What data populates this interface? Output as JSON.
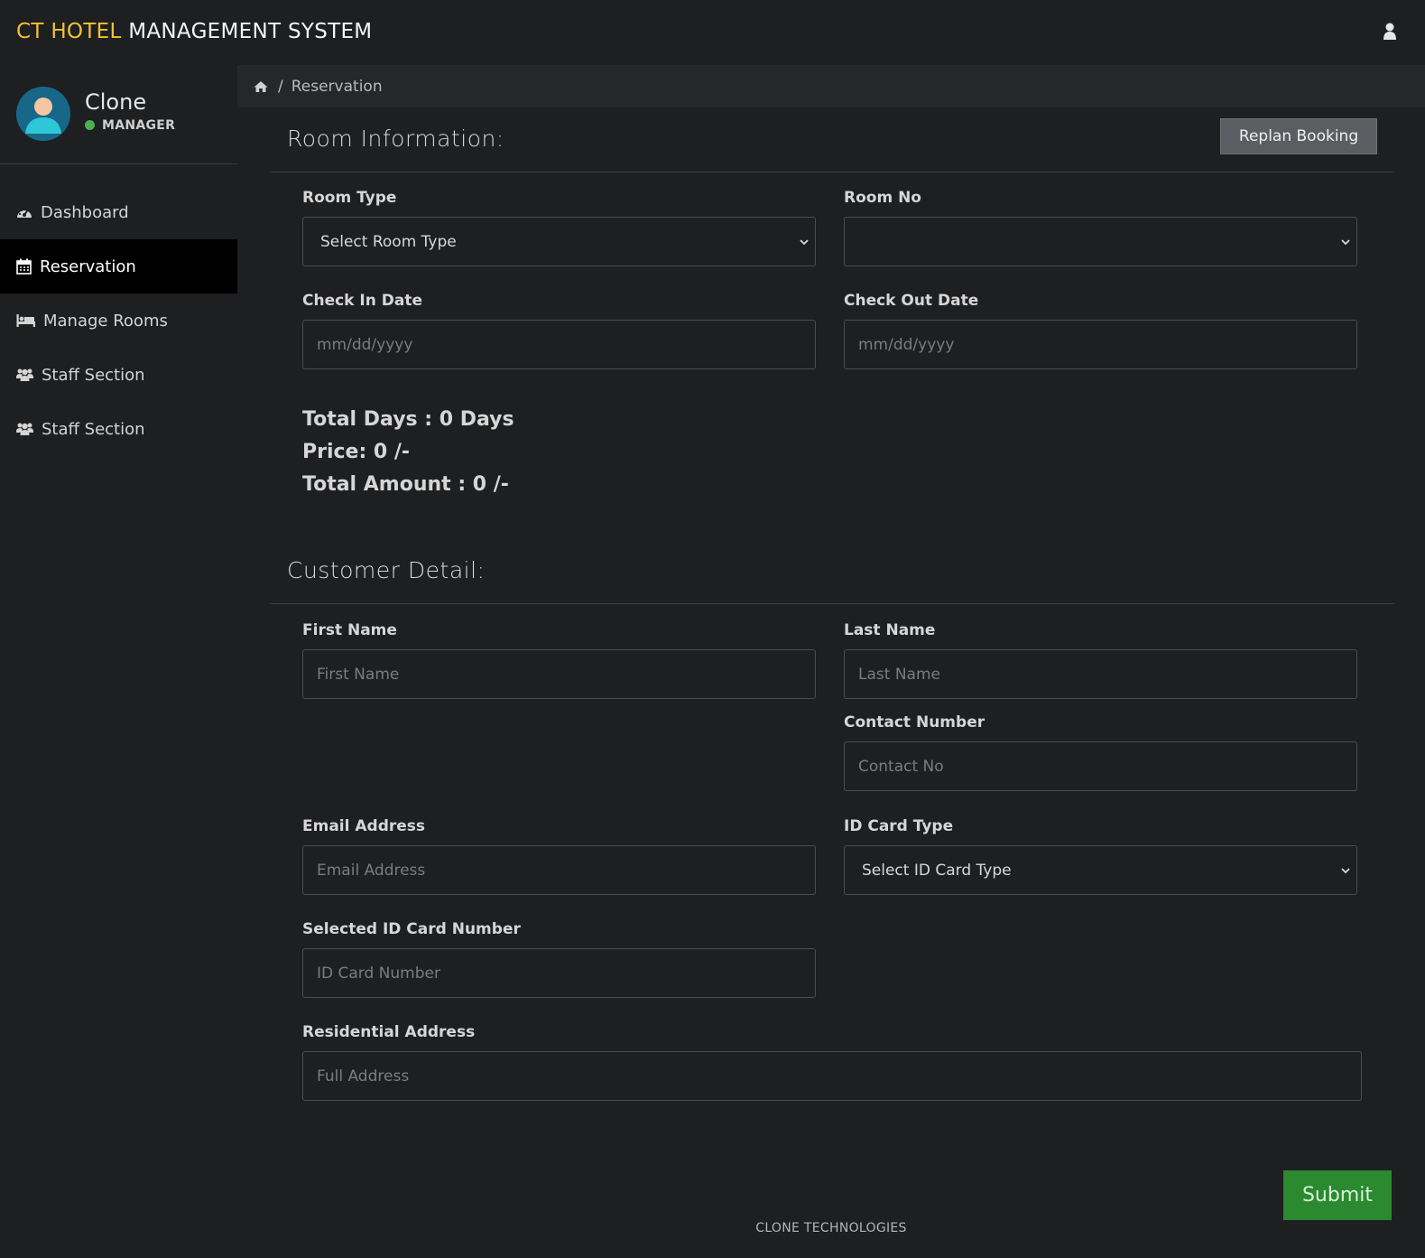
{
  "header": {
    "brand_accent": "CT HOTEL",
    "brand_rest": "MANAGEMENT SYSTEM",
    "user_icon": "user-icon",
    "accent_color": "#f1c232"
  },
  "sidebar": {
    "profile": {
      "name": "Clone",
      "role": "MANAGER",
      "status_color": "#4caf50"
    },
    "items": [
      {
        "label": "Dashboard",
        "icon": "dashboard-icon",
        "active": false
      },
      {
        "label": "Reservation",
        "icon": "calendar-icon",
        "active": true
      },
      {
        "label": "Manage Rooms",
        "icon": "bed-icon",
        "active": false
      },
      {
        "label": "Staff Section",
        "icon": "users-icon",
        "active": false
      },
      {
        "label": "Staff Section",
        "icon": "users-icon",
        "active": false
      }
    ]
  },
  "breadcrumb": {
    "home_icon": "home-icon",
    "current": "Reservation"
  },
  "room": {
    "title": "Room Information:",
    "replan_button": "Replan Booking",
    "room_type": {
      "label": "Room Type",
      "value": "Select Room Type"
    },
    "room_no": {
      "label": "Room No",
      "value": ""
    },
    "check_in": {
      "label": "Check In Date",
      "placeholder": "mm/dd/yyyy"
    },
    "check_out": {
      "label": "Check Out Date",
      "placeholder": "mm/dd/yyyy"
    },
    "total_days": "Total Days : 0 Days",
    "price": "Price: 0 /-",
    "total_amount": "Total Amount : 0 /-"
  },
  "customer": {
    "title": "Customer Detail:",
    "first_name": {
      "label": "First Name",
      "placeholder": "First Name"
    },
    "last_name": {
      "label": "Last Name",
      "placeholder": "Last Name"
    },
    "contact": {
      "label": "Contact Number",
      "placeholder": "Contact No"
    },
    "email": {
      "label": "Email Address",
      "placeholder": "Email Address"
    },
    "id_type": {
      "label": "ID Card Type",
      "value": "Select ID Card Type"
    },
    "id_number": {
      "label": "Selected ID Card Number",
      "placeholder": "ID Card Number"
    },
    "address": {
      "label": "Residential Address",
      "placeholder": "Full Address"
    }
  },
  "submit_label": "Submit",
  "submit_color": "#2b8a2f",
  "footer": "CLONE TECHNOLOGIES"
}
